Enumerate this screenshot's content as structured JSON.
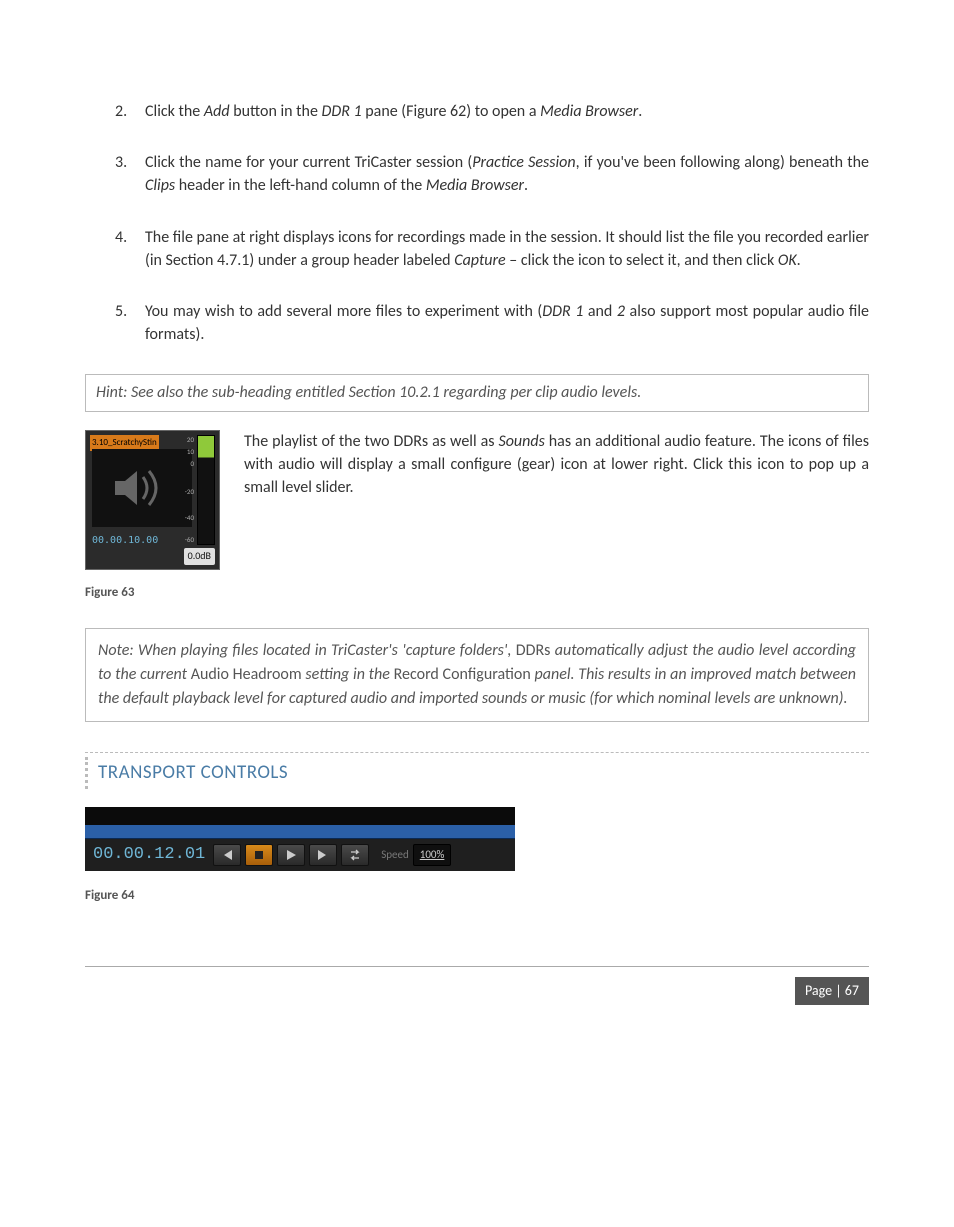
{
  "list": {
    "items": [
      {
        "num": "2.",
        "html": "Click the <em>Add</em> button in the <em>DDR 1</em> pane (Figure 62) to open a <em>Media Browser</em>."
      },
      {
        "num": "3.",
        "html": "Click the name for your current TriCaster session (<em>Practice Session</em>, if you've been following along) beneath the <em>Clips</em> header in the left-hand column of the <em>Media Browser</em>."
      },
      {
        "num": "4.",
        "html": "The file pane at right displays icons for recordings made in the session.  It should list the file you recorded earlier (in Section 4.7.1) under a group header labeled <em>Capture</em> – click the icon to select it, and then click <em>OK</em>."
      },
      {
        "num": "5.",
        "html": "You may wish to add several more files to experiment with (<em>DDR 1</em> and <em>2</em> also support most popular audio file formats)."
      }
    ]
  },
  "hint": "Hint: See also the sub-heading entitled Section 10.2.1 regarding per clip audio levels.",
  "fig63": {
    "filename": "3.10_ScratchyStin",
    "meter_ticks": [
      "20",
      "10",
      "0",
      "-20",
      "-40",
      "-60"
    ],
    "timecode": "00.00.10.00",
    "db": "0.0dB",
    "paragraph": "The playlist of the two DDRs as well as <em>Sounds</em> has an additional audio feature.  The icons of files with audio will display a small configure (gear) icon at lower right.  Click this icon to pop up a small level slider.",
    "caption": "Figure 63"
  },
  "note": "Note: When playing files located in TriCaster's 'capture folders', <span class=\"roman\">DDRs</span> automatically adjust the audio level according to the current <span class=\"roman\">Audio Headroom</span> setting in the <span class=\"roman\">Record Configuration</span> panel.  This results in an improved match between the default playback level for captured audio and imported sounds or music (for which nominal levels are unknown).",
  "section_heading": "TRANSPORT CONTROLS",
  "transport": {
    "timecode": "00.00.12.01",
    "speed_label": "Speed",
    "speed_value": "100%"
  },
  "fig64_caption": "Figure 64",
  "footer": {
    "page_label": "Page | 67"
  }
}
